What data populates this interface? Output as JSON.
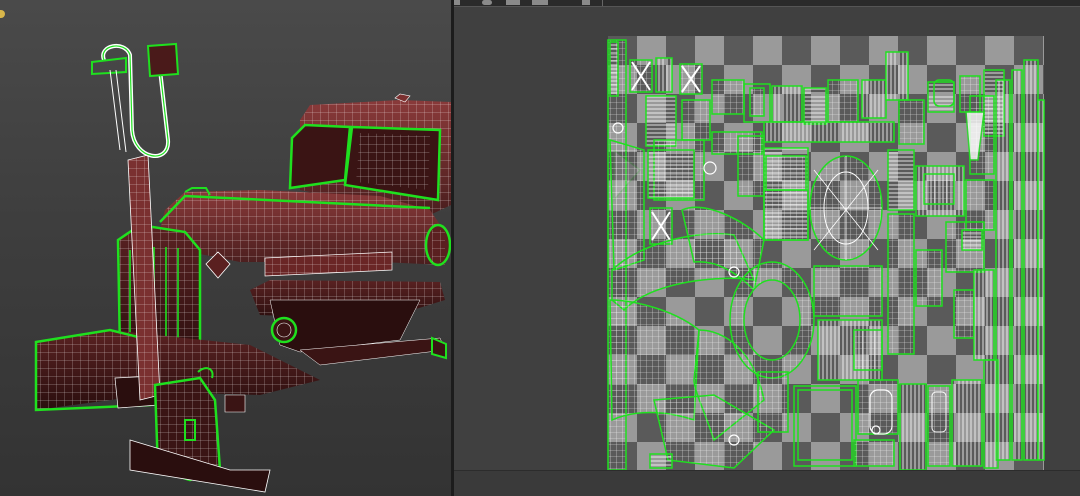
{
  "viewport": {
    "shaded_color": "#6b2a2a",
    "wire_color": "#ffffff",
    "selection_color": "#1fe01f",
    "background_color": "#404040"
  },
  "uv_editor": {
    "checker_light": "#9a9a9a",
    "checker_dark": "#5a5a5a",
    "uv_edge_color": "#ffffff",
    "selection_color": "#1fe01f"
  },
  "toolbar": {
    "icons": [
      "arrow-icon",
      "circle-icon",
      "grid-icon",
      "texture-icon",
      "dropdown-icon"
    ]
  }
}
